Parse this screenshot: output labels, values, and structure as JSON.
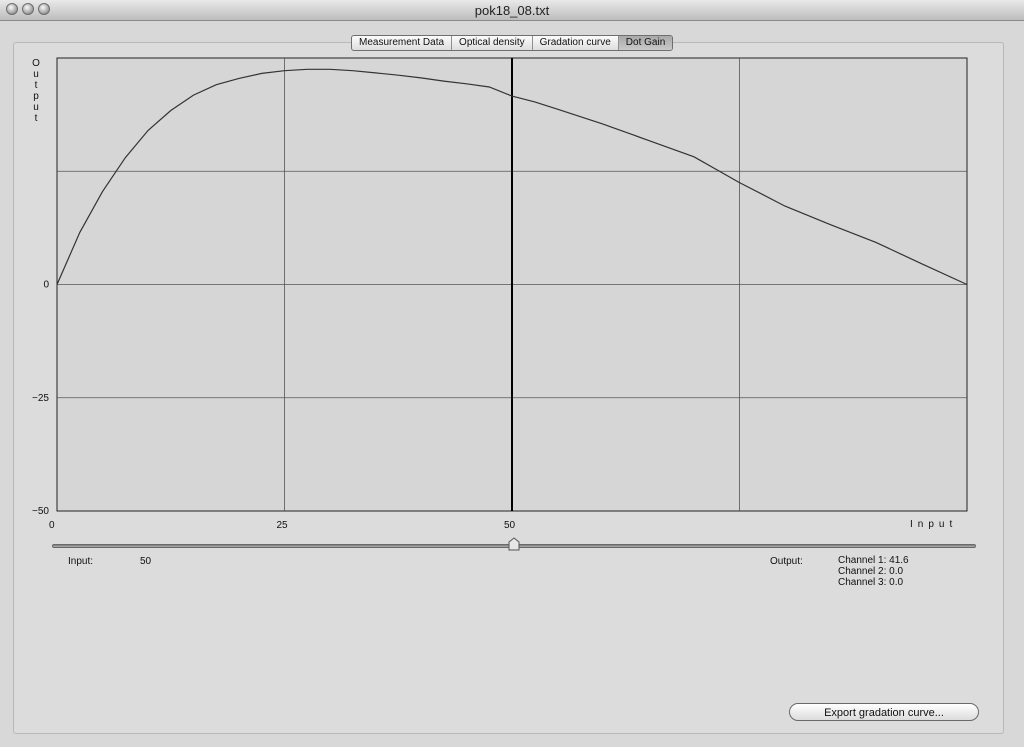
{
  "window": {
    "title": "pok18_08.txt"
  },
  "tabs": [
    {
      "label": "Measurement Data",
      "active": false
    },
    {
      "label": "Optical density",
      "active": false
    },
    {
      "label": "Gradation curve",
      "active": false
    },
    {
      "label": "Dot Gain",
      "active": true
    }
  ],
  "chart_data": {
    "type": "line",
    "ylabel": "Output",
    "xlabel": "Input",
    "xlim": [
      0,
      100
    ],
    "ylim": [
      -50,
      50
    ],
    "x_tick_labels": [
      "0",
      "25",
      "50"
    ],
    "y_tick_labels": [
      "0",
      "-25",
      "-50"
    ],
    "grid": true,
    "cursor_x": 50,
    "series": [
      {
        "x": [
          0,
          2.5,
          5,
          7.5,
          10,
          12.5,
          15,
          17.5,
          20,
          22.5,
          25,
          27.5,
          30,
          32.5,
          35,
          37.5,
          40,
          42.5,
          45,
          47.5,
          50,
          52.5,
          55,
          60,
          65,
          70,
          75,
          80,
          85,
          90,
          95,
          100
        ],
        "y": [
          0,
          11.5,
          20.5,
          28,
          34,
          38.4,
          41.8,
          44.1,
          45.5,
          46.6,
          47.2,
          47.5,
          47.5,
          47.2,
          46.7,
          46.2,
          45.6,
          44.9,
          44.3,
          43.6,
          41.6,
          40.3,
          38.7,
          35.4,
          31.8,
          28.2,
          22.5,
          17.3,
          13.2,
          9.3,
          4.6,
          0
        ]
      }
    ]
  },
  "slider": {
    "value": 50
  },
  "readout": {
    "input_label": "Input:",
    "input_value": "50",
    "output_label": "Output:",
    "channel1": "Channel 1: 41.6",
    "channel2": "Channel 2: 0.0",
    "channel3": "Channel 3: 0.0"
  },
  "export_button": {
    "label": "Export gradation curve..."
  }
}
